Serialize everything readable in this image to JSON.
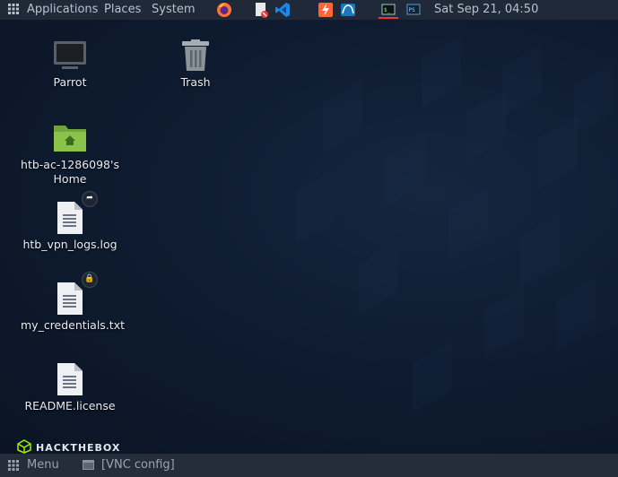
{
  "top_panel": {
    "apps_icon": "grid-icon",
    "applications": "Applications",
    "places": "Places",
    "system": "System",
    "clock": "Sat Sep 21, 04:50"
  },
  "desktop": {
    "icons": [
      {
        "label": "Parrot",
        "icon": "monitor-icon"
      },
      {
        "label": "Trash",
        "icon": "trash-icon"
      },
      {
        "label": "htb-ac-1286098's Home",
        "icon": "home-folder-icon"
      },
      {
        "label": "htb_vpn_logs.log",
        "icon": "text-file-icon",
        "emblem": "link-emblem"
      },
      {
        "label": "my_credentials.txt",
        "icon": "text-file-icon",
        "emblem": "lock-emblem"
      },
      {
        "label": "README.license",
        "icon": "text-file-icon"
      }
    ],
    "logo_text": "HACKTHEBOX"
  },
  "bottom_panel": {
    "menu": "Menu",
    "task": "[VNC config]"
  },
  "colors": {
    "panel": "#1f2937",
    "wallpaper": "#0f1c31",
    "folder_green": "#7ab648",
    "active_underline": "#e53935"
  }
}
